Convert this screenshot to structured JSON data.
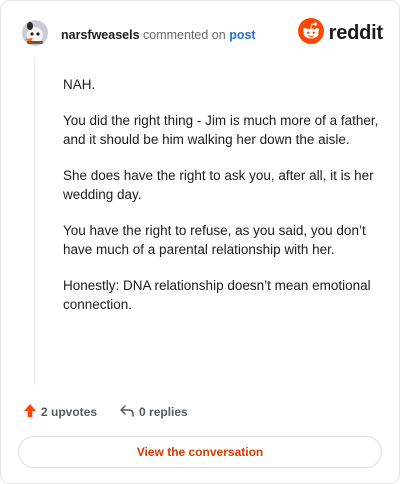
{
  "header": {
    "username": "narsfweasels",
    "action": "commented on",
    "link": "post",
    "brand": "reddit"
  },
  "comment": {
    "paragraphs": [
      "NAH.",
      "You did the right thing - Jim is much more of a father, and it should be him walking her down the aisle.",
      "She does have the right to ask you, after all, it is her wedding day.",
      "You have the right to refuse, as you said, you don’t have much of a parental relationship with her.",
      "Honestly: DNA relationship doesn’t mean emotional connection."
    ]
  },
  "footer": {
    "upvotes": "2 upvotes",
    "replies": "0 replies",
    "cta": "View the conversation"
  },
  "colors": {
    "brand_orange": "#ff4500",
    "link_blue": "#2d6ec8",
    "cta_text": "#d93a00"
  },
  "icons": {
    "avatar": "snoo-avatar-icon",
    "logo": "reddit-snoo-icon",
    "upvote": "upvote-arrow-icon",
    "reply": "reply-arrow-icon"
  }
}
